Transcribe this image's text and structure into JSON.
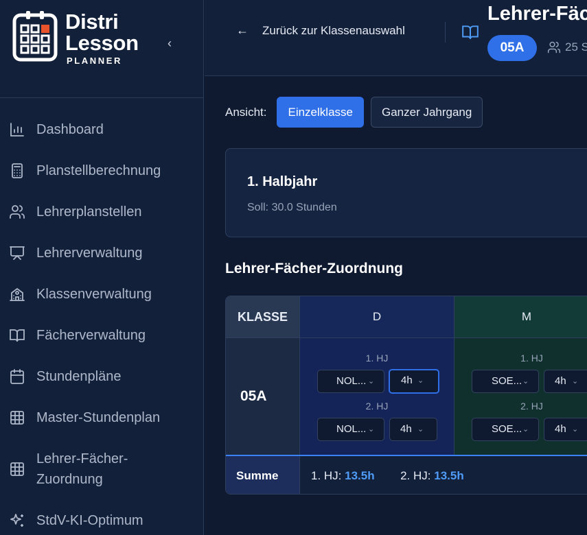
{
  "app": {
    "logo_title_line1": "Distri",
    "logo_title_line2": "Lesson",
    "logo_subtitle": "PLANNER",
    "collapse_glyph": "‹",
    "accent_color": "#2f6fe8"
  },
  "sidebar": {
    "items": [
      {
        "label": "Dashboard",
        "icon": "bar-chart-icon"
      },
      {
        "label": "Planstellberechnung",
        "icon": "calculator-icon"
      },
      {
        "label": "Lehrerplanstellen",
        "icon": "users-icon"
      },
      {
        "label": "Lehrerverwaltung",
        "icon": "presentation-icon"
      },
      {
        "label": "Klassenverwaltung",
        "icon": "school-icon"
      },
      {
        "label": "Fächerverwaltung",
        "icon": "book-icon"
      },
      {
        "label": "Stundenpläne",
        "icon": "calendar-icon"
      },
      {
        "label": "Master-Stundenplan",
        "icon": "grid-icon"
      },
      {
        "label_line1": "Lehrer-Fächer-",
        "label_line2": "Zuordnung",
        "icon": "grid-icon"
      },
      {
        "label": "StdV-KI-Optimum",
        "icon": "sparkles-icon"
      }
    ]
  },
  "header": {
    "back_label": "Zurück zur Klassenauswahl",
    "title": "Lehrer-Fäc",
    "class_badge": "05A",
    "students_text": "25 S"
  },
  "view": {
    "label": "Ansicht:",
    "options": [
      "Einzelklasse",
      "Ganzer Jahrgang"
    ],
    "selected": "Einzelklasse"
  },
  "halfyear_card": {
    "title": "1. Halbjahr",
    "subtitle": "Soll: 30.0 Stunden"
  },
  "section": {
    "title": "Lehrer-Fächer-Zuordnung"
  },
  "table": {
    "header_klasse": "KLASSE",
    "subjects": [
      "D",
      "M"
    ],
    "row": {
      "klasse": "05A",
      "cells": [
        {
          "subject": "D",
          "hj1_label": "1. HJ",
          "hj1_teacher": "NOL...",
          "hj1_hours": "4h",
          "hj2_label": "2. HJ",
          "hj2_teacher": "NOL...",
          "hj2_hours": "4h"
        },
        {
          "subject": "M",
          "hj1_label": "1. HJ",
          "hj1_teacher": "SOE...",
          "hj1_hours": "4h",
          "hj2_label": "2. HJ",
          "hj2_teacher": "SOE...",
          "hj2_hours": "4h"
        }
      ]
    },
    "summary": {
      "label": "Summe",
      "hj1_label": "1. HJ:",
      "hj1_value": "13.5h",
      "hj2_label": "2. HJ:",
      "hj2_value": "13.5h"
    }
  }
}
